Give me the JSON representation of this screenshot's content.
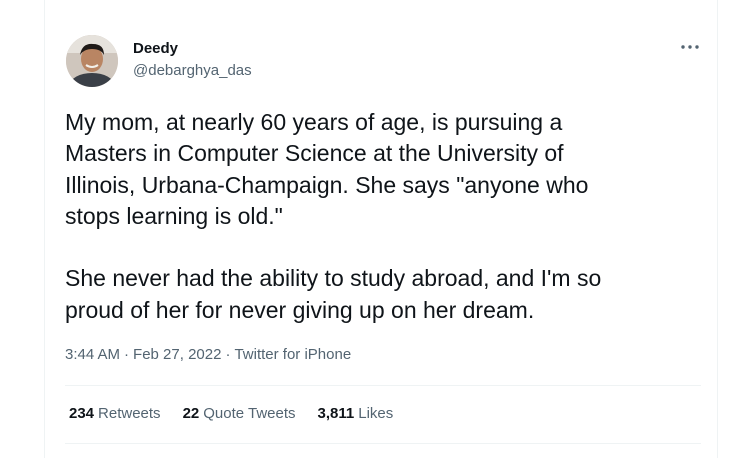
{
  "author": {
    "display_name": "Deedy",
    "handle": "@debarghya_das",
    "avatar": "avatar-photo"
  },
  "more_icon": "more-horizontal-icon",
  "tweet": {
    "text": "My mom, at nearly 60 years of age, is pursuing a\nMasters in Computer Science at the University of\nIllinois, Urbana-Champaign. She says \"anyone who\nstops learning is old.\"\n\nShe never had the ability to study abroad, and I'm so\nproud of her for never giving up on her dream."
  },
  "meta": {
    "time": "3:44 AM",
    "date": "Feb 27, 2022",
    "source": "Twitter for iPhone",
    "separator": "·"
  },
  "stats": {
    "retweets": {
      "count": "234",
      "label": "Retweets"
    },
    "quote_tweets": {
      "count": "22",
      "label": "Quote Tweets"
    },
    "likes": {
      "count": "3,811",
      "label": "Likes"
    }
  },
  "colors": {
    "text_primary": "#0f1419",
    "text_secondary": "#536471",
    "divider": "#eff3f4"
  }
}
